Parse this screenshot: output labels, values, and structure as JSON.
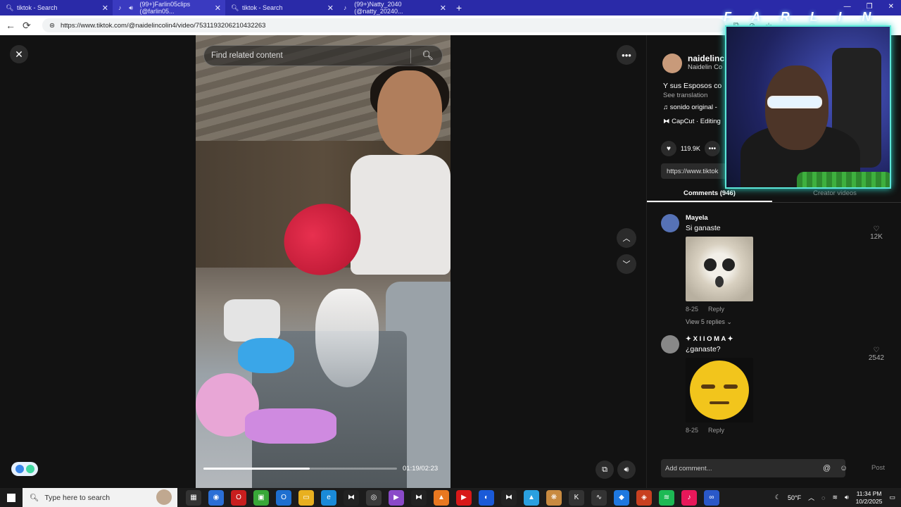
{
  "browser": {
    "tabs": [
      {
        "title": "tiktok - Search",
        "icon": "search-icon"
      },
      {
        "title": "(99+)Farlin05clips (@farlin05...",
        "icon": "tiktok-icon"
      },
      {
        "title": "tiktok - Search",
        "icon": "search-icon"
      },
      {
        "title": "(99+)Natty_2040 (@natty_20240...",
        "icon": "tiktok-icon"
      }
    ],
    "url": "https://www.tiktok.com/@naidelincolin4/video/7531193206210432263"
  },
  "video": {
    "search_placeholder": "Find related content",
    "time": "01:19/02:23",
    "progress": 0.55
  },
  "overlay": {
    "farlin_text": "F A R L I N 0 5"
  },
  "sidebar": {
    "author_name": "naidelinc",
    "author_sub": "Naidelin Co",
    "description": "Y sus Esposos co",
    "see_translation": "See translation",
    "music": "sonido original -",
    "capcut": "CapCut · Editing",
    "likes": "119.9K",
    "link": "https://www.tiktok",
    "tab_comments": "Comments (946)",
    "tab_creator": "Creator videos",
    "comments": [
      {
        "name": "Mayela",
        "text": "Si ganaste",
        "date": "8-25",
        "reply": "Reply",
        "likes": "12K",
        "view_replies": "View 5 replies"
      },
      {
        "name": "✦ X I I O M A ✦",
        "text": "¿ganaste?",
        "date": "8-25",
        "reply": "Reply",
        "likes": "2542"
      }
    ],
    "add_comment": "Add comment...",
    "post": "Post"
  },
  "taskbar": {
    "search_placeholder": "Type here to search",
    "weather": "50°F",
    "time": "11:34 PM",
    "date": "10/2/2025"
  }
}
